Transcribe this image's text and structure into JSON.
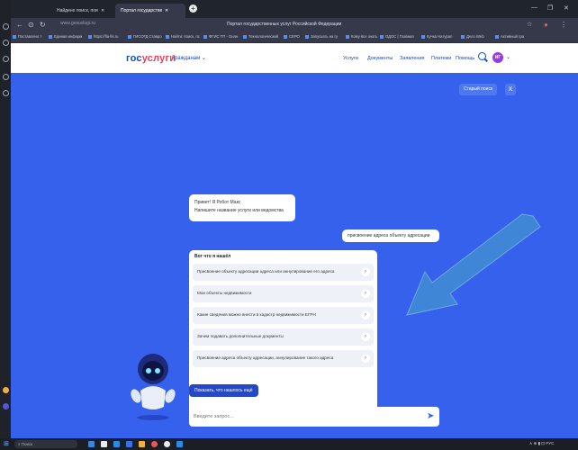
{
  "browser": {
    "tabs": [
      {
        "label": "Найдено поиск, поиск, клл",
        "active": false
      },
      {
        "label": "Портал государствен",
        "active": true
      }
    ],
    "new_tab": "+",
    "window_controls": [
      "—",
      "❐",
      "✕"
    ],
    "url": "www.gosuslugi.ru",
    "page_title": "Портал государственных услуг Российской Федерации",
    "bookmarks": [
      "Поставлено т",
      "Единая информ",
      "https://fia-fis.ru",
      "ГИСОГД Ставро",
      "Найти: поиск, пс",
      "ФГИС ТП - Онлн",
      "Технологический",
      "СЕРО",
      "Запускать на гу",
      "Кому все знать",
      "ОДОС | Главная",
      "Кучка Натурал",
      "Дело Web",
      "Активный гра"
    ]
  },
  "site": {
    "logo_main": "гос",
    "logo_accent": "услуги",
    "persona": "Гражданам",
    "nav": [
      "Услуги",
      "Документы",
      "Заявления",
      "Платежи",
      "Помощь"
    ],
    "avatar_initials": "ИГ",
    "old_search": "Старый поиск",
    "close": "X"
  },
  "chat": {
    "greeting_line1": "Привет! Я Робот Макс",
    "greeting_line2": "Напишите название услуги или ведомства",
    "user_query": "присвоение адреса объекту адресации",
    "results_title": "Вот что я нашёл",
    "results": [
      "Присвоение объекту адресации адреса или аннулирование его адреса",
      "Мои объекты недвижимости",
      "Какие сведения можно внести в кадастр недвижимости ЕГРН",
      "Зачем подавать дополнительные документы",
      "Присвоение адреса объекту адресации, аннулирование такого адреса"
    ],
    "show_more": "Показать, что нашлось ещё",
    "input_placeholder": "Введите запрос..."
  },
  "taskbar": {
    "search": "Поиск",
    "tray": "∧ ⊕ ▮ ⊡ РУС"
  },
  "colors": {
    "brand_blue": "#0d4cd3",
    "brand_red": "#ee3f58",
    "background": "#3561ec",
    "arrow": "#3f86d6"
  }
}
